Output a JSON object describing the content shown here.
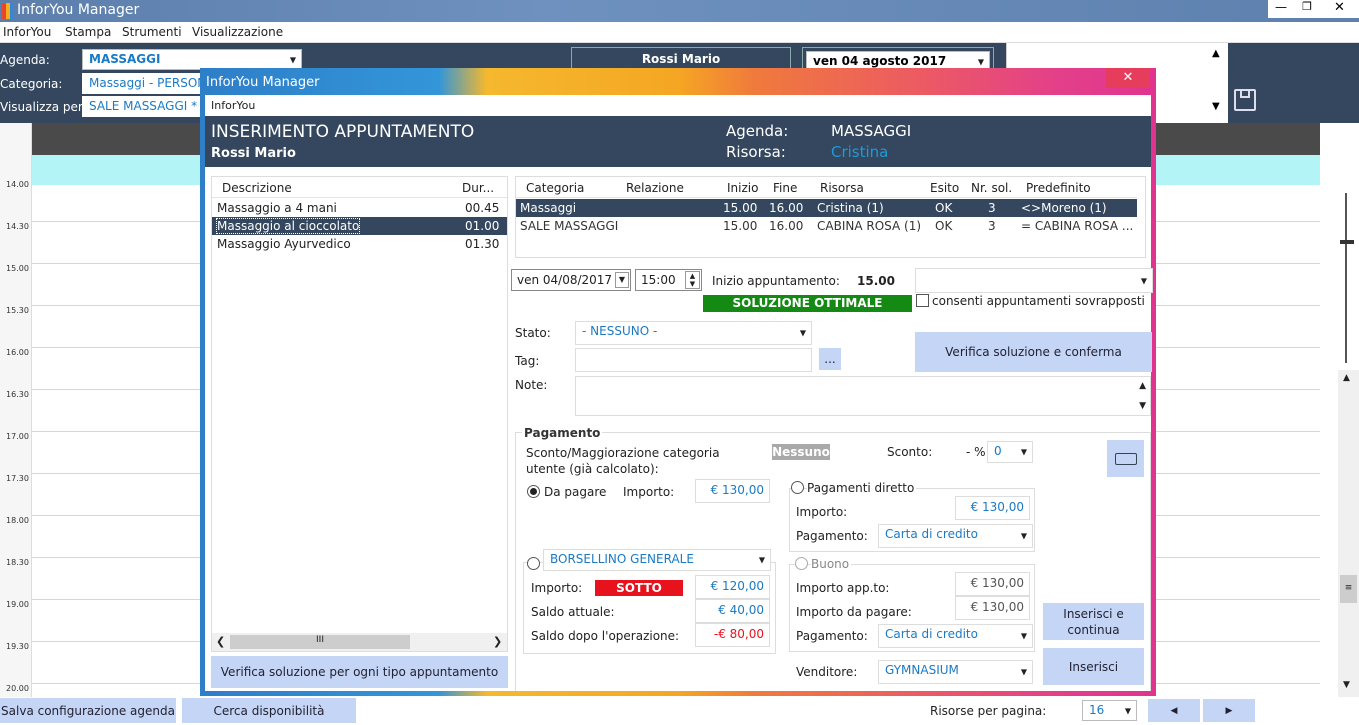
{
  "app": {
    "title": "InforYou Manager"
  },
  "menu": {
    "items": [
      "InforYou",
      "Stampa",
      "Strumenti",
      "Visualizzazione"
    ]
  },
  "toolbar": {
    "agenda_label": "Agenda:",
    "agenda_value": "MASSAGGI",
    "categoria_label": "Categoria:",
    "categoria_value": "Massaggi - PERSONA",
    "visualizza_label": "Visualizza per:",
    "visualizza_value": "SALE MASSAGGI *",
    "person": "Rossi Mario",
    "date": "ven 04   agosto   2017"
  },
  "timeline": {
    "slots": [
      "14.00",
      "14.30",
      "15.00",
      "15.30",
      "16.00",
      "16.30",
      "17.00",
      "17.30",
      "18.00",
      "18.30",
      "19.00",
      "19.30",
      "20.00"
    ]
  },
  "bottom": {
    "save_config": "Salva configurazione agenda",
    "search_avail": "Cerca disponibilità",
    "per_page_label": "Risorse per pagina:",
    "per_page_value": "16"
  },
  "dialog": {
    "title": "InforYou Manager",
    "menu": "InforYou",
    "header_title": "INSERIMENTO APPUNTAMENTO",
    "header_client": "Rossi Mario",
    "agenda_label": "Agenda:",
    "agenda_value": "MASSAGGI",
    "risorsa_label": "Risorsa:",
    "risorsa_value": "Cristina",
    "services": {
      "col_desc": "Descrizione",
      "col_dur": "Dur...",
      "rows": [
        {
          "name": "Massaggio a 4 mani",
          "dur": "00.45"
        },
        {
          "name": "Massaggio al cioccolato",
          "dur": "01.00"
        },
        {
          "name": "Massaggio Ayurvedico",
          "dur": "01.30"
        }
      ]
    },
    "verify_all_button": "Verifica soluzione per ogni tipo appuntamento",
    "resources": {
      "columns": [
        "Categoria",
        "Relazione",
        "Inizio",
        "Fine",
        "Risorsa",
        "Esito",
        "Nr. sol.",
        "Predefinito"
      ],
      "rows": [
        [
          "Massaggi",
          "",
          "15.00",
          "16.00",
          "Cristina (1)",
          "OK",
          "3",
          "<>Moreno (1)"
        ],
        [
          "SALE MASSAGGI",
          "",
          "15.00",
          "16.00",
          "CABINA  ROSA (1)",
          "OK",
          "3",
          "= CABINA  ROSA ..."
        ]
      ]
    },
    "date_value": "ven  04/08/2017",
    "time_value": "15:00",
    "inizio_label": "Inizio appuntamento:",
    "inizio_value": "15.00",
    "soluzione": "SOLUZIONE OTTIMALE",
    "overlap_label": "consenti appuntamenti sovrapposti",
    "verify_confirm_button": "Verifica soluzione e conferma",
    "stato_label": "Stato:",
    "stato_value": "- NESSUNO -",
    "tag_label": "Tag:",
    "tag_button": "...",
    "note_label": "Note:",
    "pagamento": {
      "section_title": "Pagamento",
      "sconto_cat_label": "Sconto/Maggiorazione  categoria\nutente (già calcolato):",
      "nessuno": "Nessuno",
      "sconto_label": "Sconto:",
      "sconto_pct": "- %",
      "sconto_value": "0",
      "da_pagare_label": "Da pagare",
      "importo_label": "Importo:",
      "importo_value": "€ 130,00",
      "diretto_label": "Pagamenti diretto",
      "diretto_importo_label": "Importo:",
      "diretto_importo_value": "€ 130,00",
      "diretto_pagamento_label": "Pagamento:",
      "diretto_pagamento_value": "Carta di credito",
      "borsellino_value": "BORSELLINO GENERALE",
      "bors_importo_label": "Importo:",
      "sotto_soglia": "SOTTO SOGLIA",
      "bors_importo_value": "€ 120,00",
      "saldo_attuale_label": "Saldo attuale:",
      "saldo_attuale_value": "€ 40,00",
      "saldo_dopo_label": "Saldo dopo l'operazione:",
      "saldo_dopo_value": "-€ 80,00",
      "buono_label": "Buono",
      "importo_app_label": "Importo app.to:",
      "importo_app_value": "€ 130,00",
      "importo_da_pagare_label": "Importo da pagare:",
      "importo_da_pagare_value": "€ 130,00",
      "buono_pagamento_label": "Pagamento:",
      "buono_pagamento_value": "Carta di credito",
      "venditore_label": "Venditore:",
      "venditore_value": "GYMNASIUM"
    },
    "insert_continue_button": "Inserisci e continua",
    "insert_button": "Inserisci"
  }
}
